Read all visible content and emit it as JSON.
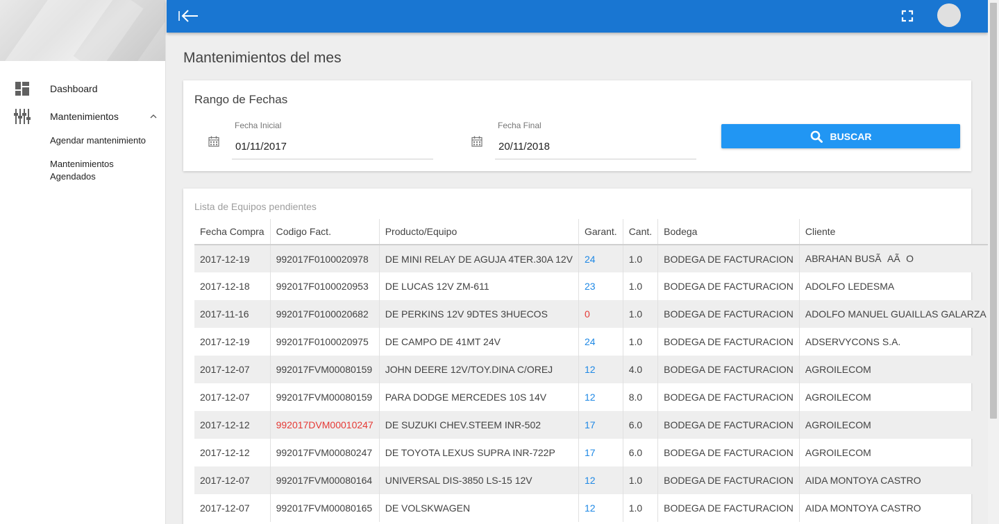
{
  "sidebar": {
    "items": [
      {
        "label": "Dashboard",
        "icon": "dashboard-icon"
      },
      {
        "label": "Mantenimientos",
        "icon": "equalizer-icon",
        "expanded": true
      }
    ],
    "subitems": [
      {
        "label": "Agendar mantenimiento"
      },
      {
        "label": "Mantenimientos Agendados"
      }
    ]
  },
  "topbar": {
    "color": "#1976d2",
    "back_icon": "collapse-left-icon",
    "fullscreen_icon": "fullscreen-icon"
  },
  "page": {
    "title": "Mantenimientos del mes"
  },
  "date_range": {
    "title": "Rango de Fechas",
    "start_label": "Fecha Inicial",
    "start_value": "01/11/2017",
    "end_label": "Fecha Final",
    "end_value": "20/11/2018",
    "search_label": "BUSCAR"
  },
  "list": {
    "title": "Lista de Equipos pendientes",
    "columns": [
      "Fecha Compra",
      "Codigo Fact.",
      "Producto/Equipo",
      "Garant.",
      "Cant.",
      "Bodega",
      "Cliente"
    ],
    "rows": [
      {
        "fecha": "2017-12-19",
        "codigo": "992017F0100020978",
        "producto": "DE MINI RELAY DE AGUJA 4TER.30A 12V",
        "garantia": "24",
        "cantidad": "1.0",
        "bodega": "BODEGA DE FACTURACION",
        "cliente": "ABRAHAN BUSÃAÃO",
        "codigo_alert": false,
        "garantia_alert": false
      },
      {
        "fecha": "2017-12-18",
        "codigo": "992017F0100020953",
        "producto": "DE LUCAS 12V ZM-611",
        "garantia": "23",
        "cantidad": "1.0",
        "bodega": "BODEGA DE FACTURACION",
        "cliente": "ADOLFO LEDESMA",
        "codigo_alert": false,
        "garantia_alert": false
      },
      {
        "fecha": "2017-11-16",
        "codigo": "992017F0100020682",
        "producto": "DE PERKINS 12V 9DTES 3HUECOS",
        "garantia": "0",
        "cantidad": "1.0",
        "bodega": "BODEGA DE FACTURACION",
        "cliente": "ADOLFO MANUEL GUAILLAS GALARZA",
        "codigo_alert": false,
        "garantia_alert": true
      },
      {
        "fecha": "2017-12-19",
        "codigo": "992017F0100020975",
        "producto": "DE CAMPO DE 41MT 24V",
        "garantia": "24",
        "cantidad": "1.0",
        "bodega": "BODEGA DE FACTURACION",
        "cliente": "ADSERVYCONS S.A.",
        "codigo_alert": false,
        "garantia_alert": false
      },
      {
        "fecha": "2017-12-07",
        "codigo": "992017FVM00080159",
        "producto": "JOHN DEERE 12V/TOY.DINA C/OREJ",
        "garantia": "12",
        "cantidad": "4.0",
        "bodega": "BODEGA DE FACTURACION",
        "cliente": "AGROILECOM",
        "codigo_alert": false,
        "garantia_alert": false
      },
      {
        "fecha": "2017-12-07",
        "codigo": "992017FVM00080159",
        "producto": "PARA DODGE MERCEDES 10S 14V",
        "garantia": "12",
        "cantidad": "8.0",
        "bodega": "BODEGA DE FACTURACION",
        "cliente": "AGROILECOM",
        "codigo_alert": false,
        "garantia_alert": false
      },
      {
        "fecha": "2017-12-12",
        "codigo": "992017DVM00010247",
        "producto": "DE SUZUKI CHEV.STEEM INR-502",
        "garantia": "17",
        "cantidad": "6.0",
        "bodega": "BODEGA DE FACTURACION",
        "cliente": "AGROILECOM",
        "codigo_alert": true,
        "garantia_alert": false
      },
      {
        "fecha": "2017-12-12",
        "codigo": "992017FVM00080247",
        "producto": "DE TOYOTA LEXUS SUPRA INR-722P",
        "garantia": "17",
        "cantidad": "6.0",
        "bodega": "BODEGA DE FACTURACION",
        "cliente": "AGROILECOM",
        "codigo_alert": false,
        "garantia_alert": false
      },
      {
        "fecha": "2017-12-07",
        "codigo": "992017FVM00080164",
        "producto": "UNIVERSAL DIS-3850 LS-15 12V",
        "garantia": "12",
        "cantidad": "1.0",
        "bodega": "BODEGA DE FACTURACION",
        "cliente": "AIDA MONTOYA CASTRO",
        "codigo_alert": false,
        "garantia_alert": false
      },
      {
        "fecha": "2017-12-07",
        "codigo": "992017FVM00080165",
        "producto": "DE VOLSKWAGEN",
        "garantia": "12",
        "cantidad": "1.0",
        "bodega": "BODEGA DE FACTURACION",
        "cliente": "AIDA MONTOYA CASTRO",
        "codigo_alert": false,
        "garantia_alert": false
      }
    ]
  },
  "colors": {
    "accent": "#2196f3",
    "link": "#1e88e5",
    "alert": "#e53935"
  }
}
